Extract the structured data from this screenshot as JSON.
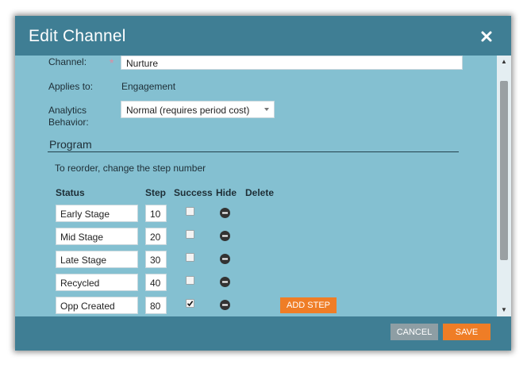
{
  "dialog": {
    "title": "Edit Channel"
  },
  "form": {
    "channel_label": "Channel:",
    "required_marker": "*",
    "channel_value": "Nurture",
    "applies_label": "Applies to:",
    "applies_value": "Engagement",
    "analytics_label_line1": "Analytics",
    "analytics_label_line2": "Behavior:",
    "analytics_value": "Normal (requires period cost)"
  },
  "program": {
    "section_title": "Program",
    "hint": "To reorder, change the step number",
    "columns": {
      "status": "Status",
      "step": "Step",
      "success": "Success",
      "hide": "Hide",
      "delete": "Delete"
    },
    "rows": [
      {
        "status": "Early Stage",
        "step": "10",
        "success": false
      },
      {
        "status": "Mid Stage",
        "step": "20",
        "success": false
      },
      {
        "status": "Late Stage",
        "step": "30",
        "success": false
      },
      {
        "status": "Recycled",
        "step": "40",
        "success": false
      },
      {
        "status": "Opp Created",
        "step": "80",
        "success": true
      }
    ],
    "add_step_label": "ADD STEP"
  },
  "footer": {
    "cancel_label": "CANCEL",
    "save_label": "SAVE"
  },
  "colors": {
    "header": "#3f7e94",
    "body": "#84c0d1",
    "accent": "#ef7d26",
    "cancel": "#8e9ea4"
  },
  "icons": {
    "close": "close-icon",
    "hide": "minus-circle-icon",
    "check": "checkmark-icon"
  }
}
